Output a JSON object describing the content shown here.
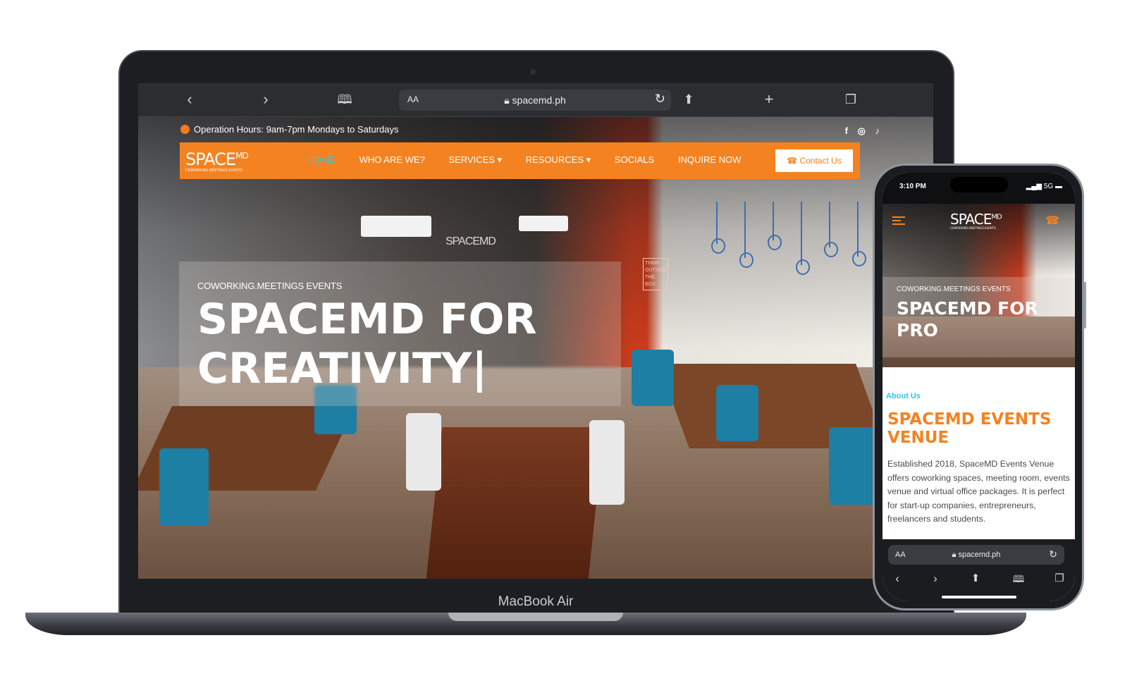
{
  "laptop": {
    "device_label": "MacBook Air",
    "browser": {
      "text_size_label": "AA",
      "url": "spacemd.ph",
      "icons": [
        "back-icon",
        "forward-icon",
        "bookmarks-icon",
        "lock-icon",
        "reload-icon",
        "share-icon",
        "new-tab-icon",
        "tabs-icon"
      ]
    },
    "site": {
      "hours": "Operation Hours: 9am-7pm Mondays to Saturdays",
      "socials": [
        "f",
        "◎",
        "♪"
      ],
      "logo": {
        "main": "SPACE",
        "sup": "MD",
        "tagline": "COWORKING.MEETINGS.EVENTS"
      },
      "nav": [
        "HOME",
        "WHO ARE WE?",
        "SERVICES ▾",
        "RESOURCES ▾",
        "SOCIALS",
        "INQUIRE NOW"
      ],
      "active_nav": "HOME",
      "contact_button": "Contact Us",
      "hero": {
        "subtitle": "COWORKING.MEETINGS EVENTS",
        "title": "SPACEMD FOR CREATIVITY|"
      },
      "wall_sign": "THINK OUTSIDE THE BOX",
      "wall_logo": "SPACEMD"
    }
  },
  "phone": {
    "status": {
      "time": "3:10 PM",
      "network": "5G"
    },
    "logo": {
      "main": "SPACE",
      "sup": "MD",
      "tagline": "COWORKING.MEETINGS.EVENTS"
    },
    "hero": {
      "subtitle": "COWORKING.MEETINGS EVENTS",
      "title": "SPACEMD FOR PRO"
    },
    "about": {
      "label": "About Us",
      "title": "SPACEMD EVENTS VENUE",
      "body": "Established 2018, SpaceMD Events Venue offers coworking spaces, meeting room, events venue and virtual office packages. It is perfect for start-up companies, entrepreneurs, freelancers and students."
    },
    "browser": {
      "text_size_label": "AA",
      "url": "spacemd.ph"
    }
  },
  "colors": {
    "brand_orange": "#f58220",
    "active_cyan": "#31c6e9",
    "accent_red": "#c93b1c"
  }
}
